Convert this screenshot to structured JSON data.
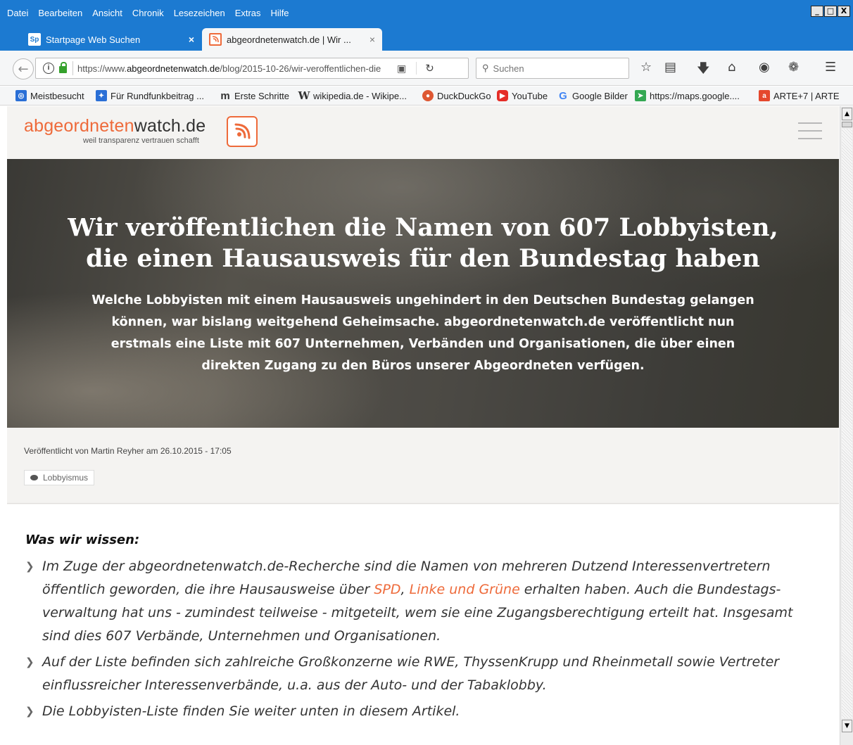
{
  "window": {
    "menu": [
      "Datei",
      "Bearbeiten",
      "Ansicht",
      "Chronik",
      "Lesezeichen",
      "Extras",
      "Hilfe"
    ],
    "controls": {
      "minimize": "_",
      "maximize": "□",
      "close": "X"
    }
  },
  "tabs": [
    {
      "favicon": "Sp",
      "title": "Startpage Web Suchen",
      "close": "×"
    },
    {
      "favicon": "",
      "title": "abgeordnetenwatch.de | Wir ...",
      "close": "×"
    }
  ],
  "newtab_label": "+",
  "urlbar": {
    "prefix": "https://www.",
    "domain": "abgeordnetenwatch.de",
    "path": "/blog/2015-10-26/wir-veroffentlichen-die"
  },
  "search": {
    "placeholder": "Suchen"
  },
  "bookmarks": [
    {
      "label": "Meistbesucht",
      "icon": "most-visited-icon",
      "color": "#2a6fd6"
    },
    {
      "label": "Für Rundfunkbeitrag ...",
      "icon": "bookmark-puzzle-icon",
      "color": "#2a6fd6"
    },
    {
      "label": "Erste Schritte",
      "icon": "m-logo-icon",
      "color": "#333333"
    },
    {
      "label": "wikipedia.de - Wikipe...",
      "icon": "wikipedia-icon",
      "color": "#333333"
    },
    {
      "label": "DuckDuckGo",
      "icon": "duckduckgo-icon",
      "color": "#de5833"
    },
    {
      "label": "YouTube",
      "icon": "youtube-icon",
      "color": "#e52d27"
    },
    {
      "label": "Google Bilder",
      "icon": "google-icon",
      "color": "#4285f4"
    },
    {
      "label": "https://maps.google....",
      "icon": "maps-icon",
      "color": "#34a853"
    },
    {
      "label": "ARTE+7 | ARTE",
      "icon": "arte-icon",
      "color": "#e5482d"
    }
  ],
  "site": {
    "logo_part1": "abgeordneten",
    "logo_part2": "watch.de",
    "tagline": "weil transparenz vertrauen schafft",
    "accent": "#ee6a3a"
  },
  "hero": {
    "title": "Wir veröffentlichen die Namen von 607 Lobbyisten, die einen Hausausweis für den Bundestag haben",
    "lead": "Welche Lobbyisten mit einem Hausausweis ungehindert in den Deutschen Bundestag gelangen können, war bislang weitgehend Geheimsache. abgeordnetenwatch.de veröffentlicht nun erstmals eine Liste mit 607 Unternehmen, Verbänden und Organisationen, die über einen direkten Zugang zu den Büros unserer Abgeordneten verfügen."
  },
  "meta": {
    "byline": "Veröffentlicht von Martin Reyher am 26.10.2015 - 17:05",
    "tag": "Lobbyismus"
  },
  "article": {
    "heading": "Was wir wissen:",
    "bullet1_a": "Im Zuge der abgeordnetenwatch.de-Recherche sind die Namen von mehreren Dutzend Interessenvertretern öffentlich geworden, die ihre Hausausweise über ",
    "bullet1_link1": "SPD",
    "bullet1_sep": ", ",
    "bullet1_link2": "Linke und Grüne",
    "bullet1_b": " erhalten haben. Auch die Bundestags-verwaltung hat uns - zumindest teilweise - mitgeteilt, wem sie eine Zugangsberechtigung erteilt hat. Insgesamt sind dies 607 Verbände, Unternehmen und Organisationen.",
    "bullet2": "Auf der Liste befinden sich zahlreiche Großkonzerne wie RWE, ThyssenKrupp und Rheinmetall sowie Vertreter einflussreicher Interessenverbände, u.a. aus der Auto- und der Tabaklobby.",
    "bullet3": "Die Lobbyisten-Liste finden Sie weiter unten in diesem Artikel."
  }
}
